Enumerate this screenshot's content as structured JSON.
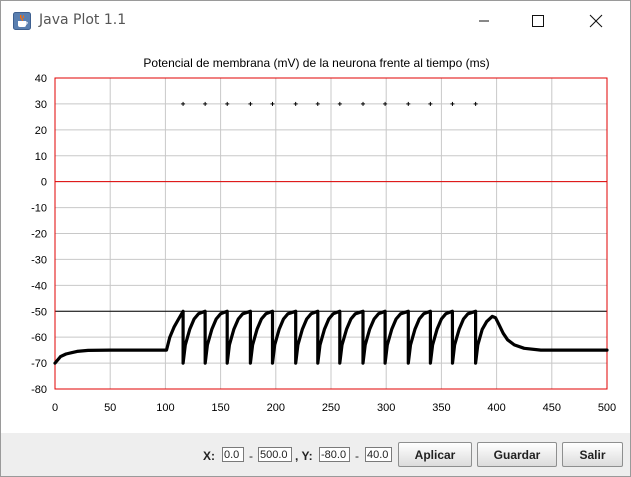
{
  "window": {
    "title": "Java Plot 1.1",
    "icon": "java-cup-icon"
  },
  "controls": {
    "x_label": "X:",
    "x_min": "0.0",
    "x_max": "500.0",
    "y_label": ", Y:",
    "y_min": "-80.0",
    "y_max": "40.0",
    "dash": "-",
    "apply_label": "Aplicar",
    "save_label": "Guardar",
    "exit_label": "Salir"
  },
  "chart_data": {
    "type": "line",
    "title": "Potencial de membrana (mV) de la neurona frente al tiempo (ms)",
    "xlabel": "",
    "ylabel": "",
    "xlim": [
      0,
      500
    ],
    "ylim": [
      -80,
      40
    ],
    "x_ticks": [
      0,
      50,
      100,
      150,
      200,
      250,
      300,
      350,
      400,
      450,
      500
    ],
    "y_ticks": [
      40,
      30,
      20,
      10,
      0,
      -10,
      -20,
      -30,
      -40,
      -50,
      -60,
      -70,
      -80
    ],
    "grid": true,
    "colors": {
      "frame": "#e00000",
      "zero_line": "#e00000",
      "grid": "#c8c8c8",
      "series": "#000000",
      "threshold": "#000000"
    },
    "threshold_line": {
      "y": -50
    },
    "series": [
      {
        "points": [
          [
            0,
            -70
          ],
          [
            5,
            -67.5
          ],
          [
            10,
            -66.5
          ],
          [
            15,
            -66
          ],
          [
            20,
            -65.5
          ],
          [
            30,
            -65.1
          ],
          [
            50,
            -65
          ],
          [
            80,
            -65
          ],
          [
            100,
            -65
          ],
          [
            101,
            -65
          ],
          [
            104,
            -60
          ],
          [
            108,
            -56
          ],
          [
            112,
            -53
          ],
          [
            116,
            -50
          ],
          [
            116.01,
            -70
          ],
          [
            118,
            -63
          ],
          [
            122,
            -57
          ],
          [
            126,
            -53
          ],
          [
            130,
            -51
          ],
          [
            136,
            -50
          ],
          [
            136.01,
            -70
          ],
          [
            138,
            -63
          ],
          [
            142,
            -57
          ],
          [
            146,
            -53
          ],
          [
            150,
            -51
          ],
          [
            156,
            -50
          ],
          [
            156.01,
            -70
          ],
          [
            158,
            -63
          ],
          [
            162,
            -57
          ],
          [
            166,
            -53
          ],
          [
            170,
            -51
          ],
          [
            177,
            -50
          ],
          [
            177.01,
            -70
          ],
          [
            179,
            -63
          ],
          [
            183,
            -57
          ],
          [
            187,
            -53
          ],
          [
            191,
            -51
          ],
          [
            197,
            -50
          ],
          [
            197.01,
            -70
          ],
          [
            199,
            -63
          ],
          [
            203,
            -57
          ],
          [
            207,
            -53
          ],
          [
            211,
            -51
          ],
          [
            218,
            -50
          ],
          [
            218.01,
            -70
          ],
          [
            220,
            -63
          ],
          [
            224,
            -57
          ],
          [
            228,
            -53
          ],
          [
            232,
            -51
          ],
          [
            238,
            -50
          ],
          [
            238.01,
            -70
          ],
          [
            240,
            -63
          ],
          [
            244,
            -57
          ],
          [
            248,
            -53
          ],
          [
            252,
            -51
          ],
          [
            258,
            -50
          ],
          [
            258.01,
            -70
          ],
          [
            260,
            -63
          ],
          [
            264,
            -57
          ],
          [
            268,
            -53
          ],
          [
            272,
            -51
          ],
          [
            279,
            -50
          ],
          [
            279.01,
            -70
          ],
          [
            281,
            -63
          ],
          [
            285,
            -57
          ],
          [
            289,
            -53
          ],
          [
            293,
            -51
          ],
          [
            299,
            -50
          ],
          [
            299.01,
            -70
          ],
          [
            301,
            -63
          ],
          [
            305,
            -57
          ],
          [
            309,
            -53
          ],
          [
            313,
            -51
          ],
          [
            320,
            -50
          ],
          [
            320.01,
            -70
          ],
          [
            322,
            -63
          ],
          [
            326,
            -57
          ],
          [
            330,
            -53
          ],
          [
            334,
            -51
          ],
          [
            340,
            -50
          ],
          [
            340.01,
            -70
          ],
          [
            342,
            -63
          ],
          [
            346,
            -57
          ],
          [
            350,
            -53
          ],
          [
            354,
            -51
          ],
          [
            360,
            -50
          ],
          [
            360.01,
            -70
          ],
          [
            362,
            -63
          ],
          [
            366,
            -57
          ],
          [
            370,
            -53
          ],
          [
            374,
            -51
          ],
          [
            381,
            -50
          ],
          [
            381.01,
            -70
          ],
          [
            383,
            -63
          ],
          [
            387,
            -57
          ],
          [
            391,
            -54
          ],
          [
            396,
            -52
          ],
          [
            399,
            -52.5
          ],
          [
            402,
            -55
          ],
          [
            406,
            -58.5
          ],
          [
            410,
            -61
          ],
          [
            416,
            -63
          ],
          [
            425,
            -64.3
          ],
          [
            440,
            -65
          ],
          [
            460,
            -65
          ],
          [
            500,
            -65
          ]
        ]
      }
    ],
    "spike_markers": {
      "y": 30,
      "x": [
        116,
        136,
        156,
        177,
        197,
        218,
        238,
        258,
        279,
        299,
        320,
        340,
        360,
        381
      ]
    }
  }
}
